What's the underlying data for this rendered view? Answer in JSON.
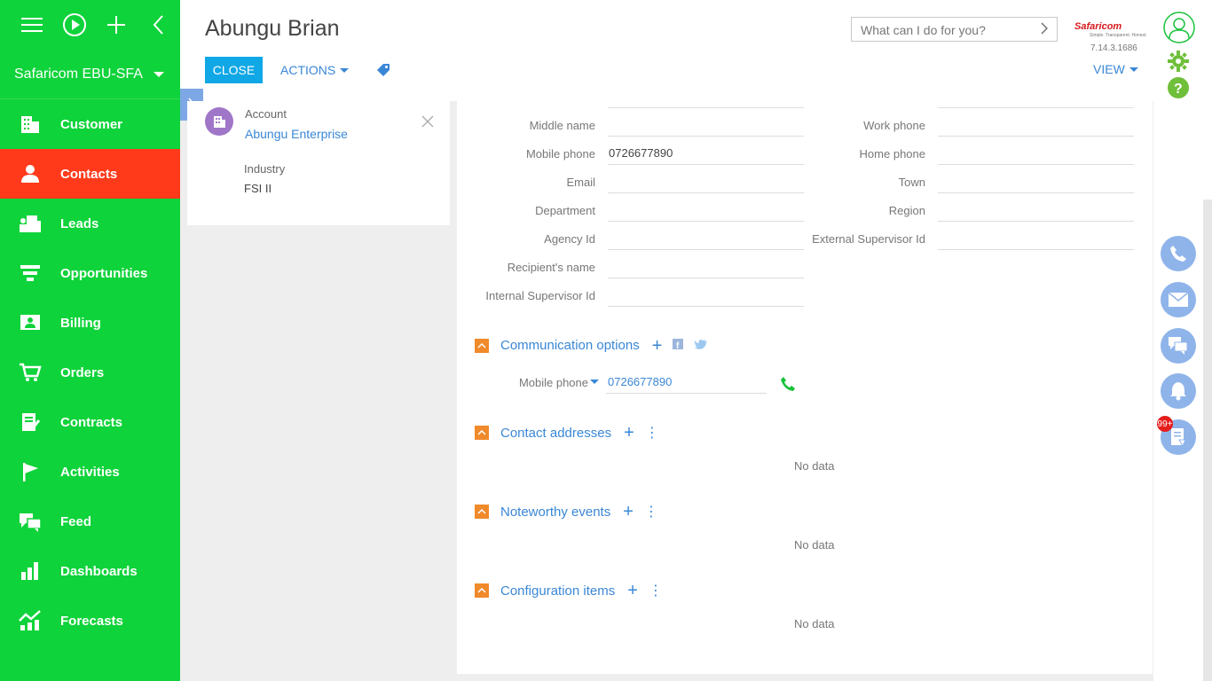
{
  "sidebar": {
    "workspace": "Safaricom EBU-SFA",
    "items": [
      {
        "label": "Customer"
      },
      {
        "label": "Contacts"
      },
      {
        "label": "Leads"
      },
      {
        "label": "Opportunities"
      },
      {
        "label": "Billing"
      },
      {
        "label": "Orders"
      },
      {
        "label": "Contracts"
      },
      {
        "label": "Activities"
      },
      {
        "label": "Feed"
      },
      {
        "label": "Dashboards"
      },
      {
        "label": "Forecasts"
      }
    ],
    "active_item": "Contacts",
    "colors": {
      "background": "#0fd33a",
      "active": "#ff3a1b"
    }
  },
  "header": {
    "title": "Abungu Brian",
    "close_label": "CLOSE",
    "actions_label": "ACTIONS",
    "view_label": "VIEW",
    "search_placeholder": "What can I do for you?",
    "logo": "Safaricom",
    "logo_sub": "Simple. Transparent. Honest.",
    "version": "7.14.3.1686"
  },
  "account_card": {
    "account_label": "Account",
    "account_value": "Abungu Enterprise",
    "industry_label": "Industry",
    "industry_value": "FSI II"
  },
  "fields_left": [
    {
      "label": "Middle name",
      "value": ""
    },
    {
      "label": "Mobile phone",
      "value": "0726677890"
    },
    {
      "label": "Email",
      "value": ""
    },
    {
      "label": "Department",
      "value": ""
    },
    {
      "label": "Agency Id",
      "value": ""
    },
    {
      "label": "Recipient's name",
      "value": ""
    },
    {
      "label": "Internal Supervisor Id",
      "value": ""
    }
  ],
  "fields_right": [
    {
      "label": "Work phone",
      "value": ""
    },
    {
      "label": "Home phone",
      "value": ""
    },
    {
      "label": "Town",
      "value": ""
    },
    {
      "label": "Region",
      "value": ""
    },
    {
      "label": "External Supervisor Id",
      "value": ""
    }
  ],
  "communication": {
    "title": "Communication options",
    "type_label": "Mobile phone",
    "value": "0726677890"
  },
  "sections": [
    {
      "title": "Contact addresses",
      "empty_text": "No data"
    },
    {
      "title": "Noteworthy events",
      "empty_text": "No data"
    },
    {
      "title": "Configuration items",
      "empty_text": "No data"
    }
  ],
  "right_panel": {
    "notification_badge": "99+",
    "icons": [
      "phone-icon",
      "mail-icon",
      "chat-icon",
      "bell-icon",
      "notes-icon"
    ]
  }
}
